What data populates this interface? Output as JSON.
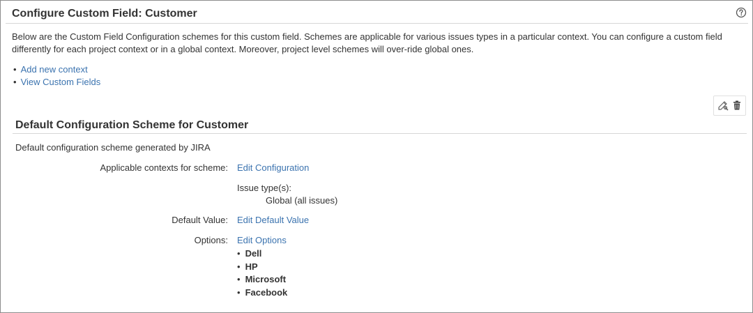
{
  "header": {
    "title": "Configure Custom Field: Customer",
    "help_icon": "question-circle-icon"
  },
  "intro": "Below are the Custom Field Configuration schemes for this custom field. Schemes are applicable for various issues types in a particular context. You can configure a custom field differently for each project context or in a global context. Moreover, project level schemes will over-ride global ones.",
  "links": [
    {
      "label": "Add new context"
    },
    {
      "label": "View Custom Fields"
    }
  ],
  "operations": {
    "edit_icon": "edit-configuration-icon",
    "delete_icon": "trash-icon"
  },
  "scheme": {
    "title": "Default Configuration Scheme for Customer",
    "description": "Default configuration scheme generated by JIRA",
    "contexts_label": "Applicable contexts for scheme:",
    "contexts_link": "Edit Configuration",
    "issue_types_label": "Issue type(s):",
    "issue_types_value": "Global (all issues)",
    "default_value_label": "Default Value:",
    "default_value_link": "Edit Default Value",
    "options_label": "Options:",
    "options_link": "Edit Options",
    "options": [
      "Dell",
      "HP",
      "Microsoft",
      "Facebook"
    ]
  },
  "colors": {
    "link": "#3b73af",
    "text": "#333333",
    "rule": "#d6d6d6"
  }
}
